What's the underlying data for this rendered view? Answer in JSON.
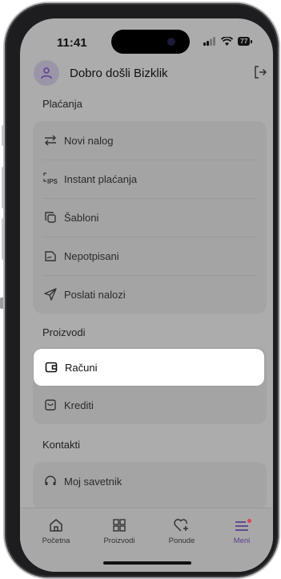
{
  "status_bar": {
    "time": "11:41",
    "battery": "77"
  },
  "header": {
    "welcome": "Dobro došli Bizklik"
  },
  "sections": {
    "payments": {
      "title": "Plaćanja",
      "items": [
        {
          "label": "Novi nalog",
          "icon": "transfer-arrows-icon"
        },
        {
          "label": "Instant plaćanja",
          "icon": "ips-icon"
        },
        {
          "label": "Šabloni",
          "icon": "copy-template-icon"
        },
        {
          "label": "Nepotpisani",
          "icon": "unsigned-icon"
        },
        {
          "label": "Poslati nalozi",
          "icon": "send-icon"
        }
      ]
    },
    "products": {
      "title": "Proizvodi",
      "items": [
        {
          "label": "Računi",
          "icon": "wallet-icon",
          "selected": true
        },
        {
          "label": "Krediti",
          "icon": "credit-icon"
        }
      ]
    },
    "contacts": {
      "title": "Kontakti",
      "items": [
        {
          "label": "Moj savetnik",
          "icon": "headset-icon"
        }
      ]
    }
  },
  "tabbar": {
    "tabs": [
      {
        "label": "Početna",
        "icon": "home-icon"
      },
      {
        "label": "Proizvodi",
        "icon": "grid-icon"
      },
      {
        "label": "Ponude",
        "icon": "heart-plus-icon"
      },
      {
        "label": "Meni",
        "icon": "menu-icon",
        "active": true
      }
    ]
  },
  "colors": {
    "accent": "#5b3f8d",
    "notification_dot": "#e0455a",
    "overlay": "#acacac"
  }
}
